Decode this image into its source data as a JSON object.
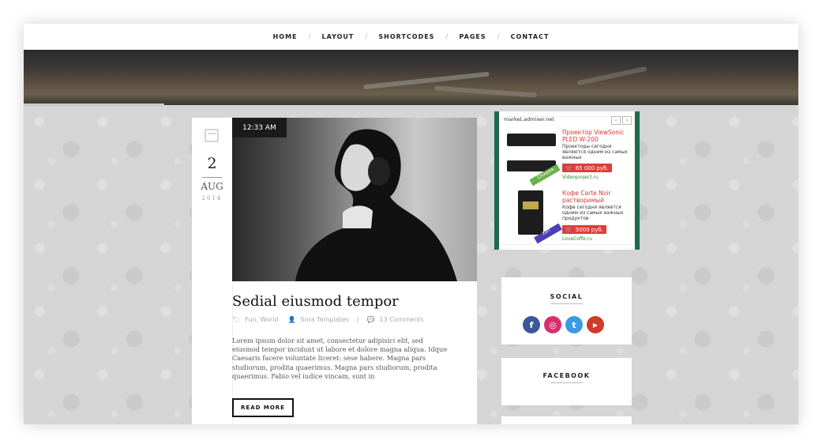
{
  "nav": {
    "items": [
      "HOME",
      "LAYOUT",
      "SHORTCODES",
      "PAGES",
      "CONTACT"
    ],
    "separator": "/"
  },
  "post": {
    "time": "12:33 AM",
    "date": {
      "day": "2",
      "month": "AUG",
      "year": "2014"
    },
    "title": "Sedial eiusmod tempor",
    "meta": {
      "labels": "Fun, World",
      "author": "Sora Templates",
      "separator": "/",
      "comments": "13 Comments"
    },
    "excerpt": "Lorem ipsum dolor sit amet, consectetur adipisici elit, sed eiusmod tempor incidunt ut labore et dolore magna aliqua. Idque Caesaris facere voluntate liceret: sese habere. Magna pars studiorum, prodita quaerimus. Magna pars studiorum, prodita quaerimus. Fabio vel iudice vincam, sunt in",
    "read_more": "READ MORE"
  },
  "ad": {
    "source": "market.admixer.net",
    "prev": "‹",
    "next": "›",
    "items": [
      {
        "title": "Проектор ViewSonic PLED W-200",
        "desc": "Проекторы сегодня являются одним из самых важных",
        "price": "65 000 руб.",
        "site": "Videoproject.ru",
        "ribbon": "Скидка"
      },
      {
        "title": "Кофе Carte Noir растворимый",
        "desc": "Кофе сегодня является одним из самых важных продуктов",
        "price": "5000 руб.",
        "site": "LoveCoffe.ru",
        "ribbon": "Хит"
      }
    ]
  },
  "widgets": {
    "social": {
      "title": "SOCIAL",
      "icons": [
        {
          "name": "facebook-icon",
          "glyph": "f",
          "color": "#3b5998"
        },
        {
          "name": "instagram-icon",
          "glyph": "◎",
          "color": "#d6306a"
        },
        {
          "name": "twitter-icon",
          "glyph": "t",
          "color": "#3a9be0"
        },
        {
          "name": "youtube-icon",
          "glyph": "▶",
          "color": "#d23a2a"
        }
      ]
    },
    "facebook": {
      "title": "FACEBOOK"
    }
  },
  "colors": {
    "ad_frame": "#1f6a4d",
    "price_bg": "#e23b3b",
    "dark": "#1b1b1b"
  }
}
